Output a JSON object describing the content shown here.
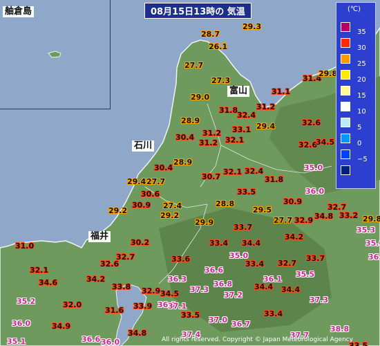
{
  "title": "08月15日13時の 気温",
  "inset_label": "舳倉島",
  "prefectures": [
    "富山",
    "石川",
    "福井"
  ],
  "legend": {
    "unit": "(℃)",
    "items": [
      {
        "color": "#b40068",
        "label": "35"
      },
      {
        "color": "#ff2800",
        "label": "30"
      },
      {
        "color": "#ff9900",
        "label": "25"
      },
      {
        "color": "#ffeb00",
        "label": "20"
      },
      {
        "color": "#fffa96",
        "label": "15"
      },
      {
        "color": "#ffffff",
        "label": "10"
      },
      {
        "color": "#b9ebff",
        "label": "5"
      },
      {
        "color": "#0096ff",
        "label": "0"
      },
      {
        "color": "#0041ff",
        "label": "−5"
      },
      {
        "color": "#002080",
        "label": ""
      }
    ]
  },
  "temperatures": [
    "29.3",
    "28.7",
    "26.1",
    "27.7",
    "27.3",
    "29.0",
    "31.1",
    "31.4",
    "29.8",
    "31.8",
    "31.2",
    "32.4",
    "28.9",
    "33.1",
    "29.4",
    "32.6",
    "31.2",
    "30.4",
    "32.1",
    "31.2",
    "32.6",
    "34.5",
    "30.4",
    "28.9",
    "35.0",
    "36.5",
    "30.7",
    "32.1",
    "32.4",
    "29.4",
    "27.7",
    "31.8",
    "36.0",
    "30.6",
    "33.5",
    "30.9",
    "29.2",
    "30.9",
    "27.4",
    "28.8",
    "29.5",
    "32.7",
    "29.2",
    "29.9",
    "27.7",
    "32.9",
    "34.8",
    "33.2",
    "29.8",
    "33.7",
    "35.3",
    "30.2",
    "33.4",
    "34.4",
    "34.2",
    "35.6",
    "31.0",
    "32.7",
    "35.0",
    "32.6",
    "33.6",
    "33.4",
    "32.7",
    "33.7",
    "36.5",
    "32.1",
    "36.6",
    "34.6",
    "34.2",
    "33.8",
    "35.5",
    "36.3",
    "36.8",
    "36.1",
    "34.4",
    "35.2",
    "32.9",
    "34.5",
    "37.3",
    "34.4",
    "37.2",
    "32.0",
    "31.6",
    "33.9",
    "36.1",
    "33.4",
    "37.3",
    "33.5",
    "37.1",
    "37.0",
    "36.7",
    "34.9",
    "36.0",
    "38.8",
    "34.8",
    "37.7",
    "35.1",
    "36.6",
    "36.0",
    "37.4",
    "33.5"
  ],
  "copyright": "All rights reserved. Copyright © Japan Meteorological Agency"
}
